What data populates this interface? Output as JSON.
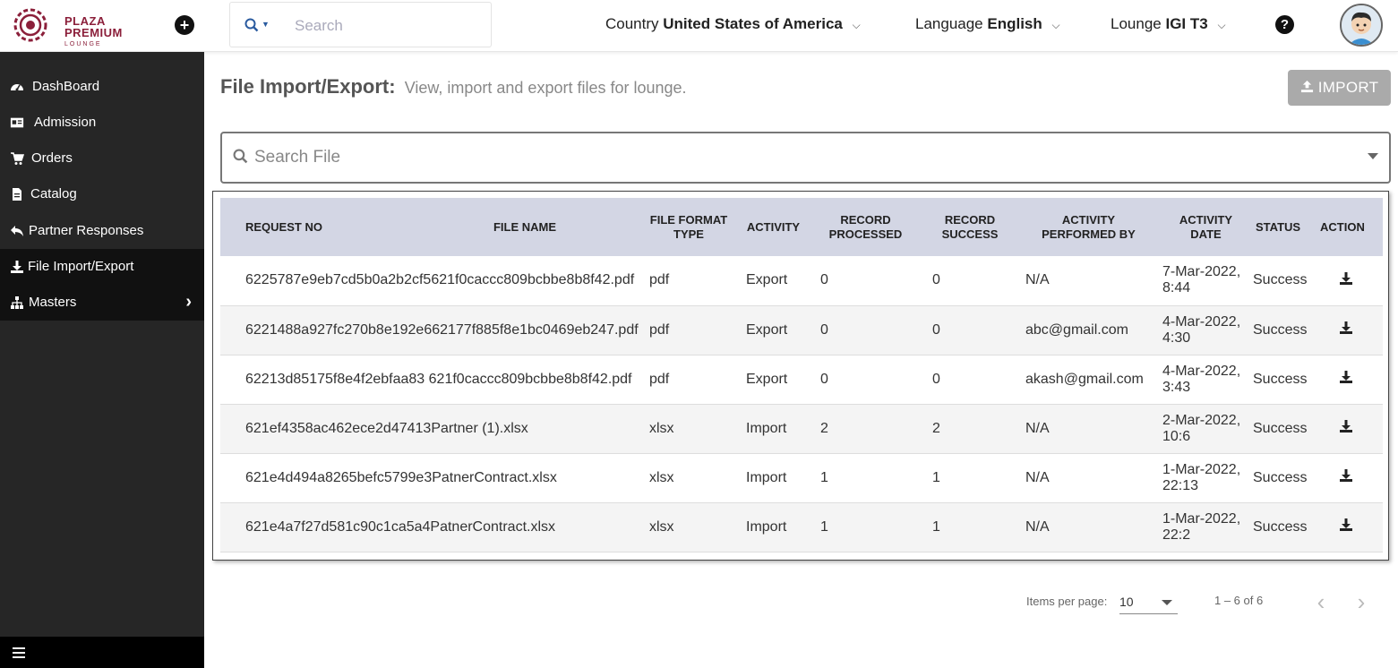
{
  "brand": {
    "line1": "PLAZA",
    "line2": "PREMIUM",
    "line3": "LOUNGE",
    "color": "#8b1f3a"
  },
  "header": {
    "search_placeholder": "Search",
    "country_label": "Country",
    "country_value": "United States of America",
    "language_label": "Language",
    "language_value": "English",
    "lounge_label": "Lounge",
    "lounge_value": "IGI T3",
    "help_glyph": "?",
    "add_glyph": "+"
  },
  "sidebar": {
    "items": [
      {
        "label": "DashBoard",
        "icon": "dashboard-icon"
      },
      {
        "label": "Admission",
        "icon": "id-card-icon"
      },
      {
        "label": "Orders",
        "icon": "cart-icon"
      },
      {
        "label": "Catalog",
        "icon": "document-icon"
      },
      {
        "label": "Partner Responses",
        "icon": "reply-icon"
      },
      {
        "label": "File Import/Export",
        "icon": "download-icon",
        "active": true
      },
      {
        "label": "Masters",
        "icon": "sitemap-icon",
        "arrow": "›"
      }
    ]
  },
  "page": {
    "title": "File Import/Export:",
    "subtitle": "View, import and export files for lounge.",
    "import_button": "IMPORT",
    "search_placeholder": "Search File"
  },
  "table": {
    "headers": {
      "request_no": "REQUEST NO",
      "file_name": "FILE NAME",
      "format_1": "FILE FORMAT",
      "format_2": "TYPE",
      "activity": "ACTIVITY",
      "processed_1": "RECORD",
      "processed_2": "PROCESSED",
      "success_1": "RECORD",
      "success_2": "SUCCESS",
      "performed_1": "ACTIVITY",
      "performed_2": "PERFORMED BY",
      "date_1": "ACTIVITY",
      "date_2": "DATE",
      "status": "STATUS",
      "action": "ACTION"
    },
    "rows": [
      {
        "request_no": "6225787e9eb7cd5b0a2b2cf5621f0caccc809bcbbe8b8f42.pdf",
        "format": "pdf",
        "activity": "Export",
        "processed": "0",
        "success": "0",
        "performed_by": "N/A",
        "date_1": "7-Mar-2022,",
        "date_2": "8:44",
        "status": "Success"
      },
      {
        "request_no": "6221488a927fc270b8e192e662177f885f8e1bc0469eb247.pdf",
        "format": "pdf",
        "activity": "Export",
        "processed": "0",
        "success": "0",
        "performed_by": "abc@gmail.com",
        "date_1": "4-Mar-2022,",
        "date_2": "4:30",
        "status": "Success"
      },
      {
        "request_no": "62213d85175f8e4f2ebfaa83 621f0caccc809bcbbe8b8f42.pdf",
        "format": "pdf",
        "activity": "Export",
        "processed": "0",
        "success": "0",
        "performed_by": "akash@gmail.com",
        "date_1": "4-Mar-2022,",
        "date_2": "3:43",
        "status": "Success"
      },
      {
        "request_no": "621ef4358ac462ece2d47413Partner (1).xlsx",
        "format": "xlsx",
        "activity": "Import",
        "processed": "2",
        "success": "2",
        "performed_by": "N/A",
        "date_1": "2-Mar-2022,",
        "date_2": "10:6",
        "status": "Success"
      },
      {
        "request_no": "621e4d494a8265befc5799e3PatnerContract.xlsx",
        "format": "xlsx",
        "activity": "Import",
        "processed": "1",
        "success": "1",
        "performed_by": "N/A",
        "date_1": "1-Mar-2022,",
        "date_2": "22:13",
        "status": "Success"
      },
      {
        "request_no": "621e4a7f27d581c90c1ca5a4PatnerContract.xlsx",
        "format": "xlsx",
        "activity": "Import",
        "processed": "1",
        "success": "1",
        "performed_by": "N/A",
        "date_1": "1-Mar-2022,",
        "date_2": "22:2",
        "status": "Success"
      }
    ]
  },
  "paginator": {
    "items_per_page_label": "Items per page:",
    "items_per_page_value": "10",
    "range": "1 – 6 of 6",
    "prev_glyph": "‹",
    "next_glyph": "›"
  }
}
